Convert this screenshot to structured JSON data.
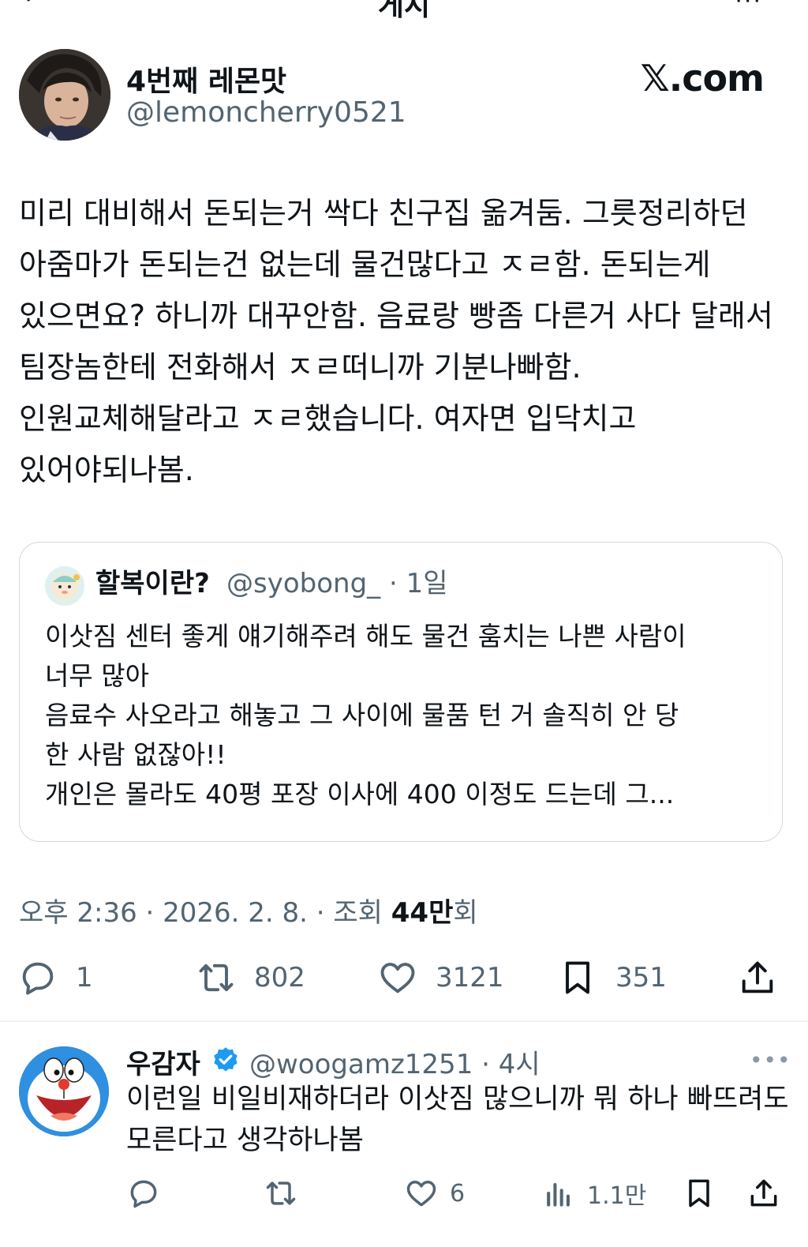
{
  "header": {
    "title": "게시",
    "more_label": "···"
  },
  "author": {
    "display_name": "4번째 레몬맛",
    "handle": "@lemoncherry0521"
  },
  "watermark": "𝕏.com",
  "tweet": {
    "text": "미리 대비해서 돈되는거 싹다 친구집 옮겨둠. 그릇정리하던 아줌마가 돈되는건 없는데 물건많다고 ㅈㄹ함. 돈되는게 있으면요? 하니까 대꾸안함. 음료랑 빵좀 다른거 사다 달래서 팀장놈한테 전화해서 ㅈㄹ떠니까 기분나빠함. 인원교체해달라고 ㅈㄹ했습니다. 여자면 입닥치고 있어야되나봄."
  },
  "quote": {
    "display_name": "할복이란?",
    "handle_time": "@syobong_ · 1일",
    "text_lines": [
      "이삿짐 센터 좋게 얘기해주려 해도 물건 훔치는 나쁜 사람이",
      "너무 많아",
      "음료수 사오라고 해놓고 그 사이에 물품 턴 거 솔직히 안 당",
      "한 사람 없잖아!!",
      "개인은 몰라도 40평 포장 이사에 400 이정도 드는데 그..."
    ]
  },
  "meta": {
    "time_date": "오후 2:36 · 2026. 2. 8. · 조회 ",
    "views": "44만",
    "views_suffix": "회"
  },
  "stats": {
    "replies": "1",
    "retweets": "802",
    "likes": "3121",
    "bookmarks": "351"
  },
  "reply": {
    "display_name": "우감자",
    "handle_time": "@woogamz1251 · 4시",
    "more_label": "•••",
    "text": "이런일 비일비재하더라 이삿짐 많으니까 뭐 하나 빠뜨려도 모른다고 생각하나봄",
    "stats": {
      "likes": "6",
      "views": "1.1만"
    }
  },
  "colors": {
    "text": "#0f1419",
    "secondary": "#536471",
    "border": "#cfd9de",
    "verified": "#1d9bf0"
  }
}
